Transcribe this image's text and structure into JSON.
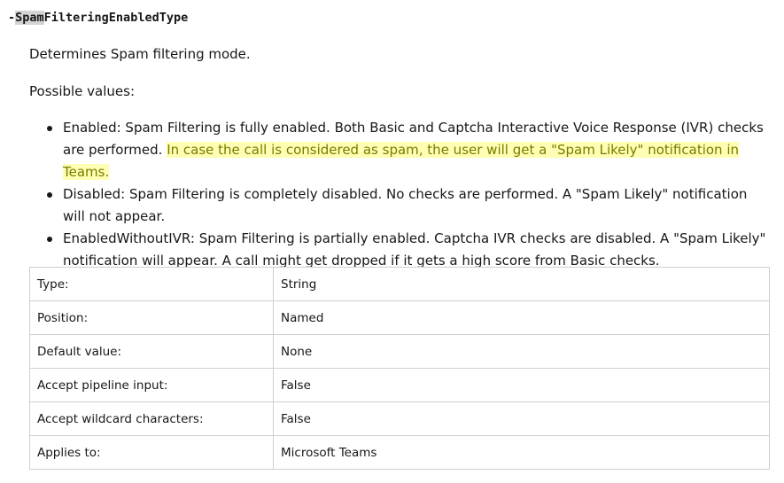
{
  "parameter": {
    "dash": "-",
    "highlighted": "Spam",
    "rest": "FilteringEnabledType"
  },
  "description": "Determines Spam filtering mode.",
  "possible_values_label": "Possible values:",
  "values": [
    {
      "text": "Enabled: Spam Filtering is fully enabled. Both Basic and Captcha Interactive Voice Response (IVR) checks are performed. ",
      "highlight": "In case the call is considered as spam, the user will get a \"Spam Likely\" notification in Teams."
    },
    {
      "text": "Disabled: Spam Filtering is completely disabled. No checks are performed. A \"Spam Likely\" notification will not appear."
    },
    {
      "text": "EnabledWithoutIVR: Spam Filtering is partially enabled. Captcha IVR checks are disabled. A \"Spam Likely\" notification will appear. A call might get dropped if it gets a high score from Basic checks."
    }
  ],
  "properties": [
    {
      "label": "Type:",
      "value": "String"
    },
    {
      "label": "Position:",
      "value": "Named"
    },
    {
      "label": "Default value:",
      "value": "None"
    },
    {
      "label": "Accept pipeline input:",
      "value": "False"
    },
    {
      "label": "Accept wildcard characters:",
      "value": "False"
    },
    {
      "label": "Applies to:",
      "value": "Microsoft Teams"
    }
  ],
  "colors": {
    "text": "#171717",
    "search_highlight": "#d4d4d4",
    "note_highlight_bg": "#ffffb3",
    "note_highlight_text": "#7a7a00",
    "table_border": "#cfcfcf"
  }
}
